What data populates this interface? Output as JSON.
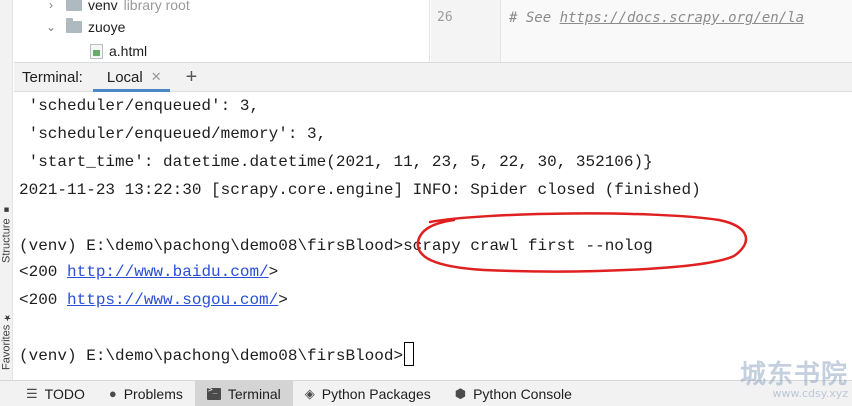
{
  "left_strip": {
    "structure_label": "Structure",
    "favorites_label": "Favorites"
  },
  "tree": {
    "items": [
      {
        "name": "venv",
        "hint": "library root",
        "expanded": false
      },
      {
        "name": "zuoye",
        "expanded": true
      },
      {
        "name": "a.html"
      }
    ]
  },
  "editor": {
    "line_number": "26",
    "comment_prefix": "# See ",
    "comment_link": "https://docs.scrapy.org/en/la"
  },
  "terminal": {
    "label": "Terminal:",
    "tab": "Local",
    "lines": [
      " 'scheduler/enqueued': 3,",
      " 'scheduler/enqueued/memory': 3,",
      " 'start_time': datetime.datetime(2021, 11, 23, 5, 22, 30, 352106)}",
      "2021-11-23 13:22:30 [scrapy.core.engine] INFO: Spider closed (finished)",
      "",
      "(venv) E:\\demo\\pachong\\demo08\\firsBlood>scrapy crawl first --nolog"
    ],
    "response_lines": [
      {
        "prefix": "<200 ",
        "url": "http://www.baidu.com/",
        "suffix": ">"
      },
      {
        "prefix": "<200 ",
        "url": "https://www.sogou.com/",
        "suffix": ">"
      }
    ],
    "prompt": "(venv) E:\\demo\\pachong\\demo08\\firsBlood>"
  },
  "bottom_bar": {
    "items": [
      {
        "label": "TODO",
        "icon": "list-icon"
      },
      {
        "label": "Problems",
        "icon": "problems-icon"
      },
      {
        "label": "Terminal",
        "icon": "terminal-icon",
        "active": true
      },
      {
        "label": "Python Packages",
        "icon": "packages-icon"
      },
      {
        "label": "Python Console",
        "icon": "python-console-icon"
      }
    ]
  },
  "watermark": {
    "main": "城东书院",
    "sub": "www.cdsy.xyz"
  },
  "colors": {
    "annotation": "#e02020",
    "link": "#2a4fd6",
    "tab_underline": "#4a88c7"
  }
}
